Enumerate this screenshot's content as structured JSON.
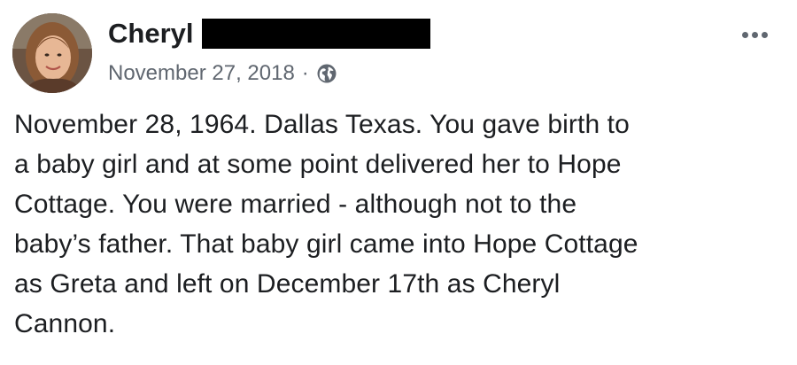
{
  "post": {
    "author": {
      "first_name": "Cheryl",
      "last_name_redacted": true,
      "avatar_icon": "profile-photo"
    },
    "timestamp": "November 27, 2018",
    "meta_separator": "·",
    "audience_icon": "globe-icon",
    "more_icon": "more-options-icon",
    "body_lines": [
      "November 28, 1964.  Dallas Texas.  You gave birth to",
      "a baby girl and at some point delivered her to Hope",
      "Cottage. You were married - although not to the",
      "baby’s father. That baby girl came into Hope Cottage",
      "as Greta and left on December 17th as Cheryl",
      "Cannon."
    ],
    "colors": {
      "text": "#1c1e21",
      "secondary_text": "#606770",
      "redaction": "#000000",
      "background": "#ffffff"
    }
  }
}
